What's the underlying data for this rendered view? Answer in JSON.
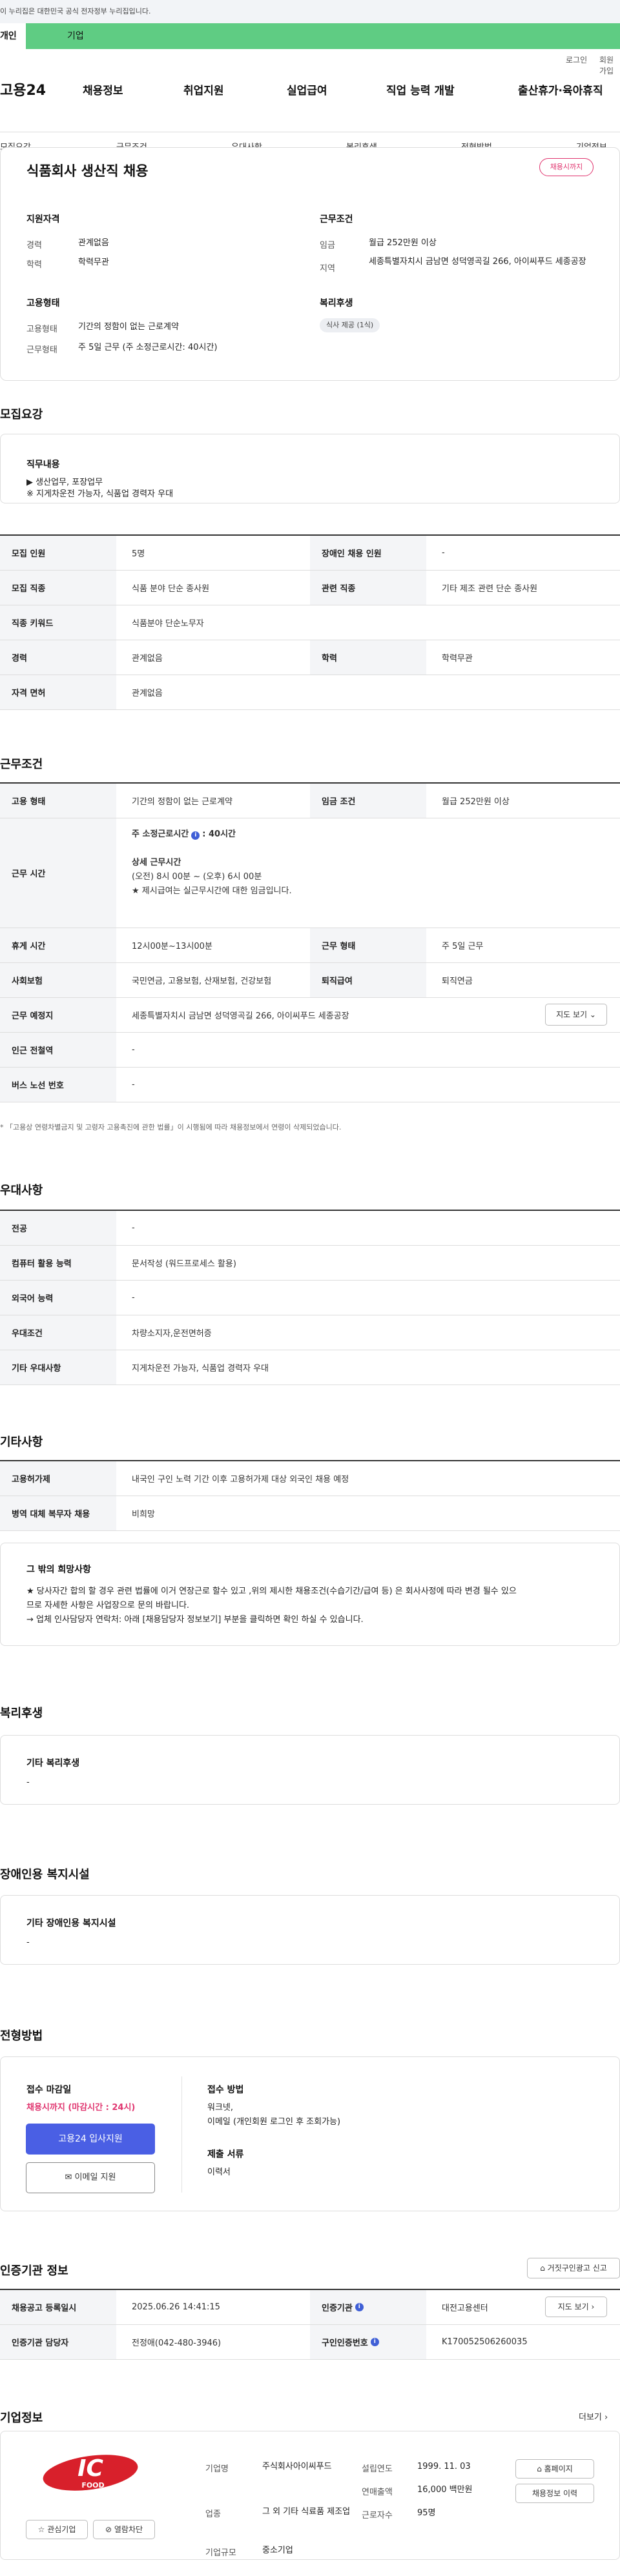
{
  "gov_banner": "이 누리집은 대한민국 공식 전자정부 누리집입니다.",
  "user_tabs": {
    "personal": "개인",
    "company": "기업"
  },
  "util": {
    "login": "로그인",
    "join": "회원가입"
  },
  "gnb": {
    "logo": "고용24",
    "menu": [
      "채용정보",
      "취업지원",
      "실업급여",
      "직업 능력 개발",
      "출산휴가·육아휴직"
    ]
  },
  "anchor_nav": [
    "모집요강",
    "근무조건",
    "우대사항",
    "복리후생",
    "전형방법",
    "기업정보"
  ],
  "job": {
    "title": "식품회사 생산직 채용",
    "badge": "채용시까지",
    "qual_head": "지원자격",
    "career_lbl": "경력",
    "career_val": "관계없음",
    "edu_lbl": "학력",
    "edu_val": "학력무관",
    "emp_head": "고용형태",
    "emp_lbl": "고용형태",
    "emp_val": "기간의 정함이 없는 근로계약",
    "hours_lbl": "근무형태",
    "hours_val": "주 5일 근무 (주 소정근로시간: 40시간)",
    "cond_head": "근무조건",
    "wage_lbl": "임금",
    "wage_val": "월급 252만원 이상",
    "region_lbl": "지역",
    "region_val": "세종특별자치시 금남면 성덕영곡길 266, 아이씨푸드 세종공장",
    "welfare_head": "복리후생",
    "welfare_chip": "식사 제공 (1식)"
  },
  "recruit": {
    "title": "모집요강",
    "duty_title": "직무내용",
    "duty_lines": [
      "▶ 생산업무, 포장업무",
      "※ 지게차운전 가능자, 식품업 경력자 우대"
    ],
    "rows": [
      {
        "l1": "모집 인원",
        "v1": "5명",
        "l2": "장애인 채용 인원",
        "v2": "-"
      },
      {
        "l1": "모집 직종",
        "v1": "식품 분야 단순 종사원",
        "l2": "관련 직종",
        "v2": "기타 제조 관련 단순 종사원"
      },
      {
        "l1": "직종 키워드",
        "v1": "식품분야 단순노무자"
      },
      {
        "l1": "경력",
        "v1": "관계없음",
        "l2": "학력",
        "v2": "학력무관"
      },
      {
        "l1": "자격 면허",
        "v1": "관계없음"
      }
    ]
  },
  "work": {
    "title": "근무조건",
    "emp_lbl": "고용 형태",
    "emp_val": "기간의 정함이 없는 근로계약",
    "wage_lbl": "임금 조건",
    "wage_val": "월급 252만원 이상",
    "time_lbl": "근무 시간",
    "time_weekly": "주 소정근로시간",
    "time_weekly_val": ": 40시간",
    "time_detail_head": "상세 근무시간",
    "time_detail": "(오전) 8시 00분 ~ (오후) 6시 00분",
    "time_note": "★ 제시급여는 실근무시간에 대한 임금입니다.",
    "break_lbl": "휴게 시간",
    "break_val": "12시00분~13시00분",
    "shift_lbl": "근무 형태",
    "shift_val": "주 5일 근무",
    "ins_lbl": "사회보험",
    "ins_val": "국민연금, 고용보험, 산재보험, 건강보험",
    "ret_lbl": "퇴직급여",
    "ret_val": "퇴직연금",
    "place_lbl": "근무 예정지",
    "place_val": "세종특별자치시 금남면 성덕영곡길 266, 아이씨푸드 세종공장",
    "map_btn": "지도 보기",
    "subway_lbl": "인근 전철역",
    "subway_val": "-",
    "bus_lbl": "버스 노선 번호",
    "bus_val": "-",
    "note": "* 「고용상 연령차별금지 및 고령자 고용촉진에 관한 법률」이 시행됨에 따라 채용정보에서 연령이 삭제되었습니다."
  },
  "prefer": {
    "title": "우대사항",
    "rows": [
      {
        "l": "전공",
        "v": "-"
      },
      {
        "l": "컴퓨터 활용 능력",
        "v": "문서작성 (워드프로세스 활용)"
      },
      {
        "l": "외국어 능력",
        "v": "-"
      },
      {
        "l": "우대조건",
        "v": "차량소지자,운전면허증"
      },
      {
        "l": "기타 우대사항",
        "v": "지게차운전 가능자, 식품업 경력자 우대"
      }
    ]
  },
  "etc": {
    "title": "기타사항",
    "rows": [
      {
        "l": "고용허가제",
        "v": "내국인 구인 노력 기간 이후 고용허가제 대상 외국인 채용 예정"
      },
      {
        "l": "병역 대체 복무자 채용",
        "v": "비희망"
      }
    ],
    "other_title": "그 밖의 희망사항",
    "other_lines": [
      "★ 당사자간 합의 할 경우 관련 법률에 이거 연장근로 할수 있고 ,위의 제시한 채용조건(수습기간/급여 등) 은 회사사정에 따라 변경 될수 있으",
      "므로 자세한 사항은 사업장으로 문의 바랍니다.",
      "→ 업체 인사담당자 연락처: 아래 [채용담당자 정보보기] 부분을 클릭하면 확인 하실 수 있습니다."
    ]
  },
  "welfare": {
    "title": "복리후생",
    "box_title": "기타 복리후생",
    "box_val": "-"
  },
  "disability": {
    "title": "장애인용 복지시설",
    "box_title": "기타 장애인용 복지시설",
    "box_val": "-"
  },
  "screening": {
    "title": "전형방법",
    "deadline_head": "접수 마감일",
    "deadline_val": "채용시까지 (마감시간 : 24시)",
    "apply_btn": "고용24 입사지원",
    "email_btn": "이메일 지원",
    "method_head": "접수 방법",
    "method_lines": [
      "워크넷,",
      "이메일 (개인회원 로그인 후 조회가능)"
    ],
    "docs_head": "제출 서류",
    "docs_val": "이력서"
  },
  "agency": {
    "title": "인증기관 정보",
    "report_btn": "거짓구인광고 신고",
    "reg_lbl": "채용공고 등록일시",
    "reg_val": "2025.06.26 14:41:15",
    "org_lbl": "인증기관",
    "org_val": "대전고용센터",
    "map_btn": "지도 보기",
    "mgr_lbl": "인증기관 담당자",
    "mgr_val": "전정애(042-480-3946)",
    "no_lbl": "구인인증번호",
    "no_val": "K170052506260035"
  },
  "company": {
    "title": "기업정보",
    "more": "더보기",
    "logo_text": "IC",
    "logo_sub": "FOOD",
    "fav_btn": "관심기업",
    "block_btn": "열람차단",
    "name_lbl": "기업명",
    "name_val": "주식회사아이씨푸드",
    "biz_lbl": "업종",
    "biz_val": "그 외 기타 식료품 제조업",
    "size_lbl": "기업규모",
    "size_val": "중소기업",
    "year_lbl": "설립연도",
    "year_val": "1999. 11. 03",
    "sales_lbl": "연매출액",
    "sales_val": "16,000 백만원",
    "staff_lbl": "근로자수",
    "staff_val": "95명",
    "home_btn": "홈페이지",
    "hist_btn": "채용정보 이력"
  }
}
